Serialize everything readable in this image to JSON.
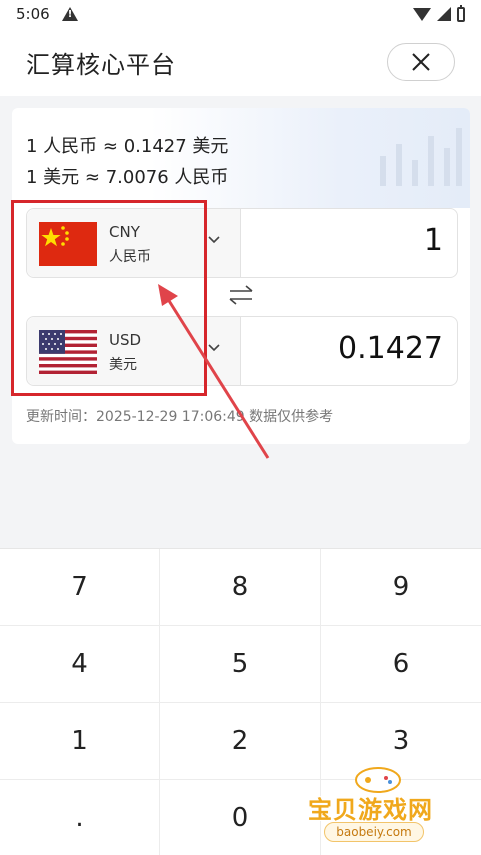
{
  "status_bar": {
    "time": "5:06",
    "warning_icon": "warning-icon",
    "wifi_icon": "wifi-icon",
    "signal_icon": "signal-icon",
    "battery_icon": "battery-icon"
  },
  "header": {
    "title": "汇算核心平台",
    "close_icon": "close-icon"
  },
  "rates": {
    "line1": "1 人民币 ≈ 0.1427 美元",
    "line2": "1 美元 ≈ 7.0076 人民币"
  },
  "from_currency": {
    "code": "CNY",
    "name": "人民币",
    "amount": "1",
    "flag_icon": "china-flag-icon"
  },
  "to_currency": {
    "code": "USD",
    "name": "美元",
    "amount": "0.1427",
    "flag_icon": "us-flag-icon"
  },
  "swap_icon": "swap-arrows-icon",
  "update_text": "更新时间：2025-12-29 17:06:49 数据仅供参考",
  "keypad": [
    "7",
    "8",
    "9",
    "4",
    "5",
    "6",
    "1",
    "2",
    "3",
    ".",
    "0",
    ""
  ],
  "watermark": {
    "text": "宝贝游戏网",
    "url_text": "baobeiy.com"
  },
  "colors": {
    "highlight": "#d6262b",
    "watermark": "#f0a81c",
    "card_bg": "#ffffff",
    "page_bg": "#f3f4f6"
  }
}
